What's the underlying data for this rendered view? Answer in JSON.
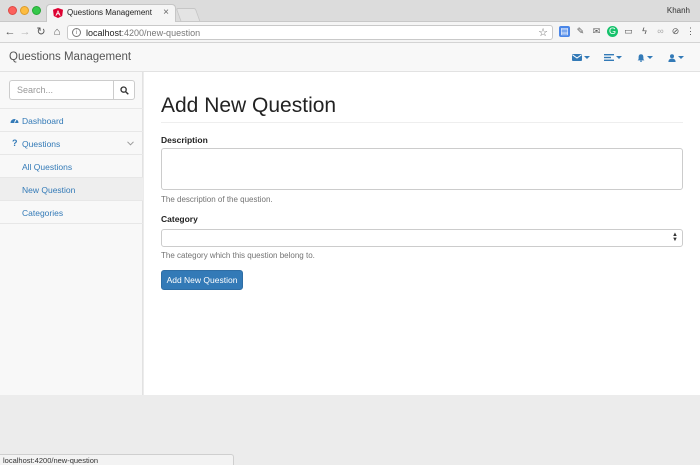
{
  "browser": {
    "tab_title": "Questions Management",
    "user_name": "Khanh",
    "url_host": "localhost",
    "url_path": ":4200/new-question",
    "status_url": "localhost:4200/new-question"
  },
  "navbar": {
    "brand": "Questions Management",
    "icons": [
      "envelope-icon",
      "tasks-icon",
      "bell-icon",
      "user-icon"
    ]
  },
  "sidebar": {
    "search_placeholder": "Search...",
    "items": [
      {
        "label": "Dashboard",
        "icon": "dashboard-icon"
      },
      {
        "label": "Questions",
        "icon": "question-icon"
      },
      {
        "label": "All Questions"
      },
      {
        "label": "New Question",
        "active": true
      },
      {
        "label": "Categories"
      }
    ]
  },
  "form": {
    "title": "Add New Question",
    "description_label": "Description",
    "description_value": "",
    "description_help": "The description of the question.",
    "category_label": "Category",
    "category_value": "",
    "category_help": "The category which this question belong to.",
    "submit_label": "Add New Question"
  },
  "colors": {
    "accent": "#337ab7",
    "navbar_bg": "#f8f8f8"
  }
}
